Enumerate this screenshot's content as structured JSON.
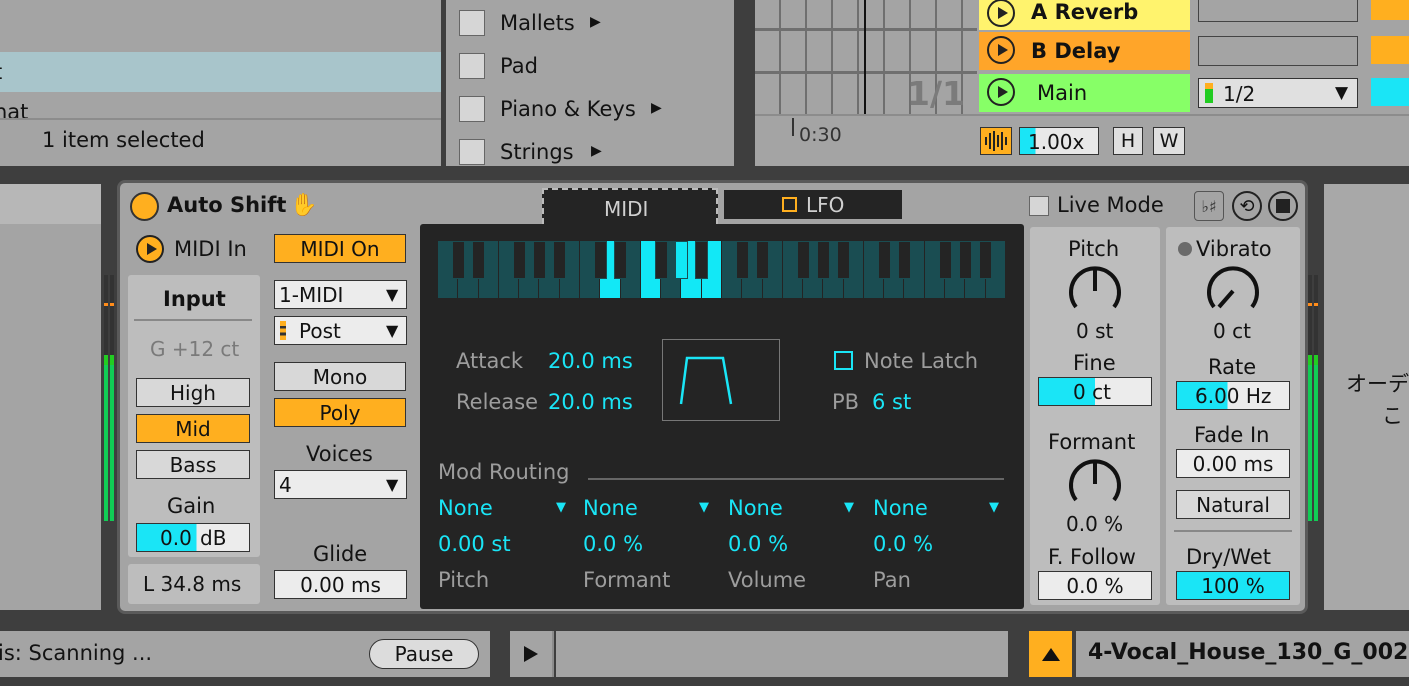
{
  "browser": {
    "status": "1 item selected",
    "partial_row1": "t",
    "partial_row2": "nat",
    "categories": [
      {
        "label": "Mallets",
        "arrow": "▶"
      },
      {
        "label": "Pad",
        "arrow": ""
      },
      {
        "label": "Piano & Keys",
        "arrow": "▶"
      },
      {
        "label": "Strings",
        "arrow": "▶"
      }
    ]
  },
  "session": {
    "time_marker": "0:30",
    "loop_label": "1/1",
    "tracks": [
      {
        "name": "A Reverb",
        "color": "#fff36d"
      },
      {
        "name": "B Delay",
        "color": "#ffa529"
      },
      {
        "name": "Main",
        "color": "#87ff67"
      }
    ],
    "main_io_select": "1/2",
    "zoom": "1.00x",
    "h_btn": "H",
    "w_btn": "W"
  },
  "device": {
    "title": "Auto Shift",
    "tabs": {
      "midi": "MIDI",
      "lfo": "LFO"
    },
    "live_mode_label": "Live Mode",
    "left": {
      "midi_in": "MIDI In",
      "midi_on": "MIDI On",
      "input_label": "Input",
      "key_readout": "G +12 ct",
      "high": "High",
      "mid": "Mid",
      "bass": "Bass",
      "gain_label": "Gain",
      "gain_value": "0.0",
      "gain_unit": "dB",
      "latency": "L 34.8 ms",
      "midi_source": "1-MIDI",
      "midi_tap": "Post Mixer",
      "mono": "Mono",
      "poly": "Poly",
      "voices_label": "Voices",
      "voices_value": "4",
      "glide_label": "Glide",
      "glide_value": "0.00 ms"
    },
    "center": {
      "attack_label": "Attack",
      "attack_value": "20.0 ms",
      "release_label": "Release",
      "release_value": "20.0 ms",
      "note_latch": "Note Latch",
      "pb_label": "PB",
      "pb_value": "6 st",
      "mod_routing_label": "Mod Routing",
      "mod_slots": [
        {
          "source": "None",
          "amount": "0.00 st",
          "target": "Pitch"
        },
        {
          "source": "None",
          "amount": "0.0 %",
          "target": "Formant"
        },
        {
          "source": "None",
          "amount": "0.0 %",
          "target": "Volume"
        },
        {
          "source": "None",
          "amount": "0.0 %",
          "target": "Pan"
        }
      ]
    },
    "right1": {
      "pitch_label": "Pitch",
      "pitch_value": "0 st",
      "fine_label": "Fine",
      "fine_value": "0 ct",
      "formant_label": "Formant",
      "formant_value": "0.0 %",
      "ffollow_label": "F. Follow",
      "ffollow_value": "0.0 %"
    },
    "right2": {
      "vibrato_label": "Vibrato",
      "vibrato_value": "0 ct",
      "rate_label": "Rate",
      "rate_value": "6.00 Hz",
      "fade_label": "Fade In",
      "fade_value": "0.00 ms",
      "natural": "Natural",
      "drywet_label": "Dry/Wet",
      "drywet_value": "100 %"
    }
  },
  "jp_text": {
    "line1": "オーデ",
    "line2": "こ"
  },
  "statusbar": {
    "scanning": "is: Scanning ...",
    "pause": "Pause",
    "clip_name": "4-Vocal_House_130_G_002"
  },
  "colors": {
    "accent": "#ffaf1f",
    "cyan": "#1ae5f6",
    "panel": "#a4a4a4",
    "dark": "#242424"
  }
}
